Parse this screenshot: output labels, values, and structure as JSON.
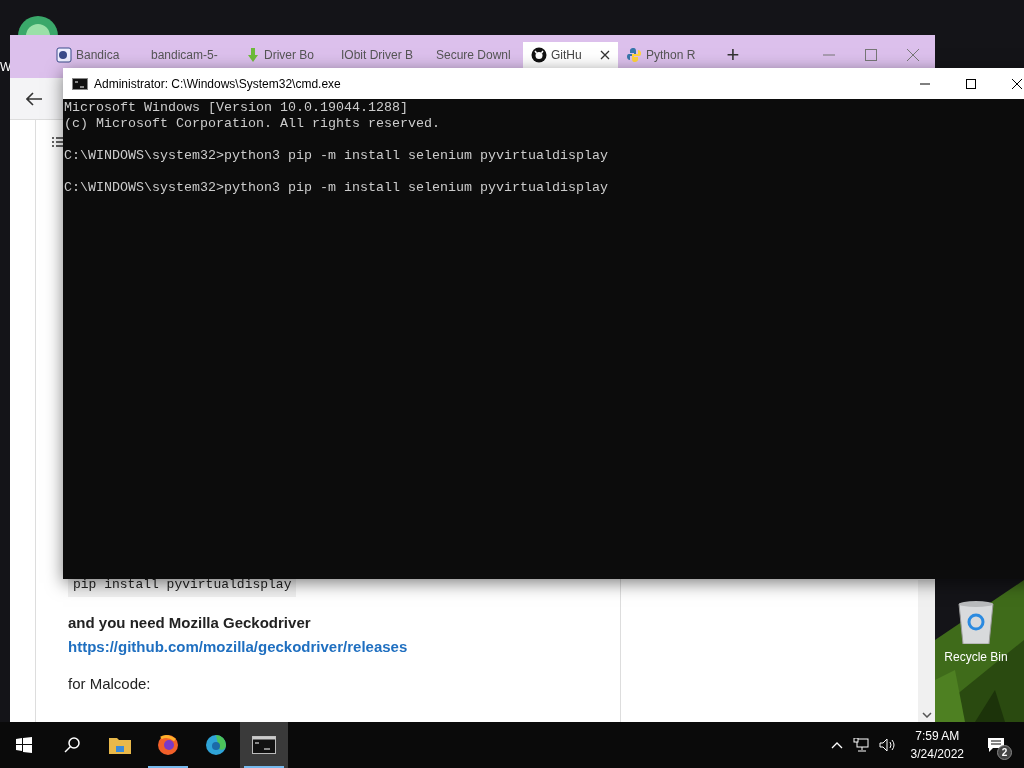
{
  "desktop": {
    "edge_label": "W",
    "icons": [
      {
        "label": "Recycle Bin"
      }
    ]
  },
  "browser": {
    "tabs": [
      {
        "title": "Bandica",
        "kind": "bandicam",
        "selected": false
      },
      {
        "title": "bandicam-5-",
        "kind": "none",
        "selected": false
      },
      {
        "title": "Driver Bo",
        "kind": "download",
        "selected": false
      },
      {
        "title": "IObit Driver B",
        "kind": "none",
        "selected": false
      },
      {
        "title": "Secure Downl",
        "kind": "none",
        "selected": false
      },
      {
        "title": "GitHu",
        "kind": "github",
        "selected": true
      },
      {
        "title": "Python R",
        "kind": "python",
        "selected": false
      }
    ],
    "new_tab": "+",
    "content": {
      "code": "pip install pyvirtualdisplay",
      "paragraph": "and you need Mozilla Geckodriver",
      "link": "https://github.com/mozilla/geckodriver/releases",
      "paragraph_2": "for Malcode:"
    }
  },
  "console": {
    "title": "Administrator: C:\\Windows\\System32\\cmd.exe",
    "blocks": [
      [
        "Microsoft Windows [Version 10.0.19044.1288]",
        "(c) Microsoft Corporation. All rights reserved."
      ],
      [
        "C:\\WINDOWS\\system32>python3 pip -m install selenium pyvirtualdisplay"
      ],
      [
        "C:\\WINDOWS\\system32>python3 pip -m install selenium pyvirtualdisplay"
      ]
    ]
  },
  "taskbar": {
    "apps": [
      {
        "kind": "start",
        "running": false,
        "selected": false
      },
      {
        "kind": "search",
        "running": false,
        "selected": false
      },
      {
        "kind": "explorer",
        "running": false,
        "selected": false
      },
      {
        "kind": "firefox",
        "running": true,
        "selected": false
      },
      {
        "kind": "edge",
        "running": false,
        "selected": false
      },
      {
        "kind": "terminal",
        "running": true,
        "selected": true
      }
    ],
    "time": "7:59 AM",
    "date": "3/24/2022",
    "notifications": "2"
  }
}
